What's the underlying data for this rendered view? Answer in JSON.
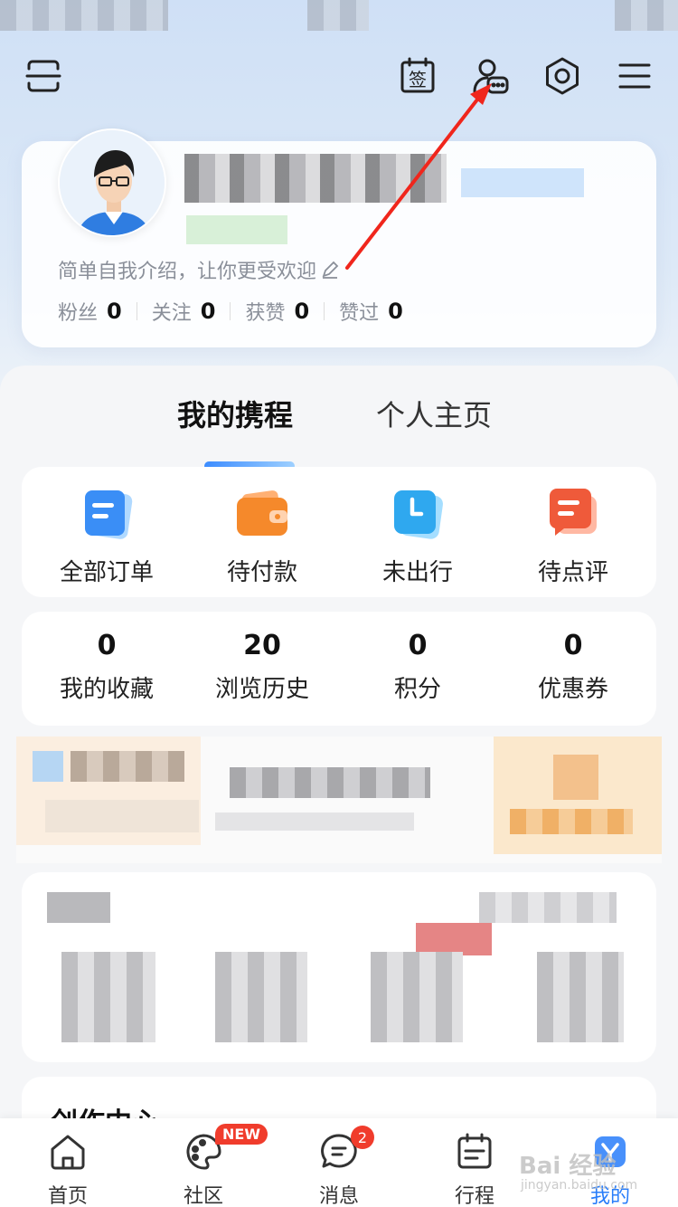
{
  "profile": {
    "intro": "简单自我介绍，让你更受欢迎",
    "stats": [
      {
        "label": "粉丝",
        "value": "0"
      },
      {
        "label": "关注",
        "value": "0"
      },
      {
        "label": "获赞",
        "value": "0"
      },
      {
        "label": "赞过",
        "value": "0"
      }
    ]
  },
  "topbar": {
    "icons": [
      "scan-icon",
      "checkin-icon",
      "customer-service-icon",
      "settings-icon",
      "menu-icon"
    ],
    "checkin_char": "签"
  },
  "tabs": {
    "active": "我的携程",
    "inactive": "个人主页"
  },
  "orders": [
    {
      "label": "全部订单",
      "icon": "all-orders-icon",
      "color": "#3a8ef6"
    },
    {
      "label": "待付款",
      "icon": "wallet-icon",
      "color": "#f5892b"
    },
    {
      "label": "未出行",
      "icon": "clock-icon",
      "color": "#2fa8ef"
    },
    {
      "label": "待点评",
      "icon": "comment-icon",
      "color": "#ef5a3a"
    }
  ],
  "counts": [
    {
      "num": "0",
      "label": "我的收藏"
    },
    {
      "num": "20",
      "label": "浏览历史"
    },
    {
      "num": "0",
      "label": "积分"
    },
    {
      "num": "0",
      "label": "优惠券"
    }
  ],
  "create_center": {
    "title": "创作中心"
  },
  "bottom_nav": [
    {
      "label": "首页",
      "icon": "home-icon",
      "active": false
    },
    {
      "label": "社区",
      "icon": "palette-icon",
      "active": false,
      "badge": "NEW"
    },
    {
      "label": "消息",
      "icon": "message-icon",
      "active": false,
      "badge": "2"
    },
    {
      "label": "行程",
      "icon": "calendar-icon",
      "active": false
    },
    {
      "label": "我的",
      "icon": "profile-icon",
      "active": true
    }
  ],
  "watermark": {
    "main": "Bai 经验",
    "sub": "jingyan.baidu.com"
  },
  "colors": {
    "accent": "#287dfa",
    "badge": "#f03c2c",
    "annotation_arrow": "#f0261c"
  }
}
